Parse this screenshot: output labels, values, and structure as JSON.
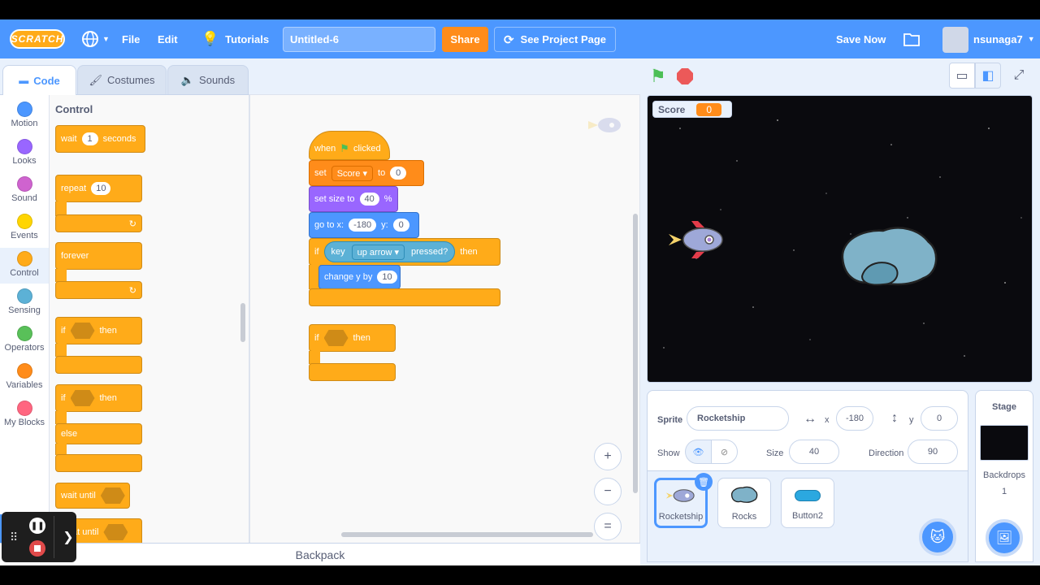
{
  "menubar": {
    "logo": "SCRATCH",
    "file": "File",
    "edit": "Edit",
    "tutorials": "Tutorials",
    "project_title": "Untitled-6",
    "share": "Share",
    "see_project_page": "See Project Page",
    "save_now": "Save Now",
    "username": "nsunaga7"
  },
  "tabs": {
    "code": "Code",
    "costumes": "Costumes",
    "sounds": "Sounds"
  },
  "categories": [
    {
      "label": "Motion",
      "color": "#4c97ff"
    },
    {
      "label": "Looks",
      "color": "#9966ff"
    },
    {
      "label": "Sound",
      "color": "#cf63cf"
    },
    {
      "label": "Events",
      "color": "#ffd500"
    },
    {
      "label": "Control",
      "color": "#ffab19"
    },
    {
      "label": "Sensing",
      "color": "#5cb1d6"
    },
    {
      "label": "Operators",
      "color": "#59c059"
    },
    {
      "label": "Variables",
      "color": "#ff8c1a"
    },
    {
      "label": "My Blocks",
      "color": "#ff6680"
    }
  ],
  "palette": {
    "heading": "Control",
    "wait": "wait",
    "wait_val": "1",
    "seconds": "seconds",
    "repeat": "repeat",
    "repeat_val": "10",
    "forever": "forever",
    "if1": "if",
    "then1": "then",
    "if2": "if",
    "then2": "then",
    "else": "else",
    "wait_until": "wait until",
    "repeat_until": "at until"
  },
  "script": {
    "when": "when",
    "clicked": "clicked",
    "set": "set",
    "set_var": "Score",
    "to": "to",
    "set_val": "0",
    "set_size": "set size to",
    "size_val": "40",
    "pct": "%",
    "goto": "go to x:",
    "goto_x": "-180",
    "y": "y:",
    "goto_y": "0",
    "if": "if",
    "key": "key",
    "key_name": "up arrow",
    "pressed": "pressed?",
    "then": "then",
    "change_y": "change y by",
    "change_val": "10",
    "if2": "if",
    "then2": "then"
  },
  "zoom": {
    "in": "+",
    "out": "−",
    "reset": "="
  },
  "stage": {
    "monitor_label": "Score",
    "monitor_value": "0"
  },
  "sprite_info": {
    "sprite_label": "Sprite",
    "sprite_name": "Rocketship",
    "x_label": "x",
    "x_val": "-180",
    "y_label": "y",
    "y_val": "0",
    "show_label": "Show",
    "size_label": "Size",
    "size_val": "40",
    "direction_label": "Direction",
    "direction_val": "90"
  },
  "sprites": [
    {
      "name": "Rocketship"
    },
    {
      "name": "Rocks"
    },
    {
      "name": "Button2"
    }
  ],
  "stage_panel": {
    "title": "Stage",
    "backdrops": "Backdrops",
    "backdrops_count": "1"
  },
  "backpack": "Backpack"
}
